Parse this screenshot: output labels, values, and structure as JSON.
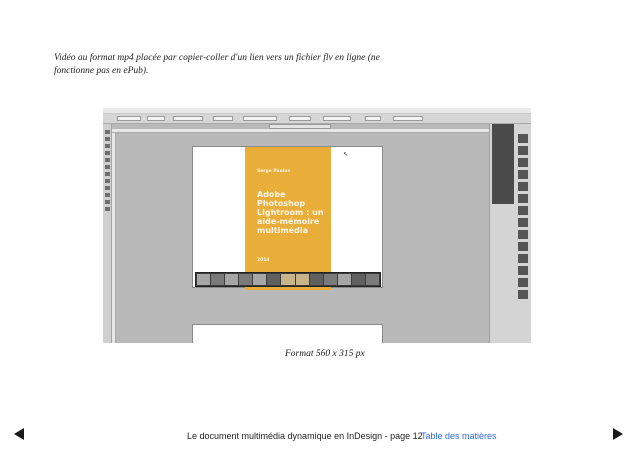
{
  "caption_top": "Vidéo au format mp4 placée par copier-coller d'un lien vers un fichier flv en ligne (ne fonctionne pas en ePub).",
  "video": {
    "cover": {
      "author": "Serge Paulus",
      "title": "Adobe Photoshop Lightroom : un aide-mémoire multimédia",
      "year": "2014"
    }
  },
  "caption_format": "Format 560 x 315 px",
  "footer": {
    "page_text": "Le document multimédia dynamique en InDesign - page 12",
    "toc_link": "Table des matières",
    "link_color": "#2e69d6"
  },
  "icons": {
    "prev": "triangle-left-icon",
    "next": "triangle-right-icon"
  }
}
